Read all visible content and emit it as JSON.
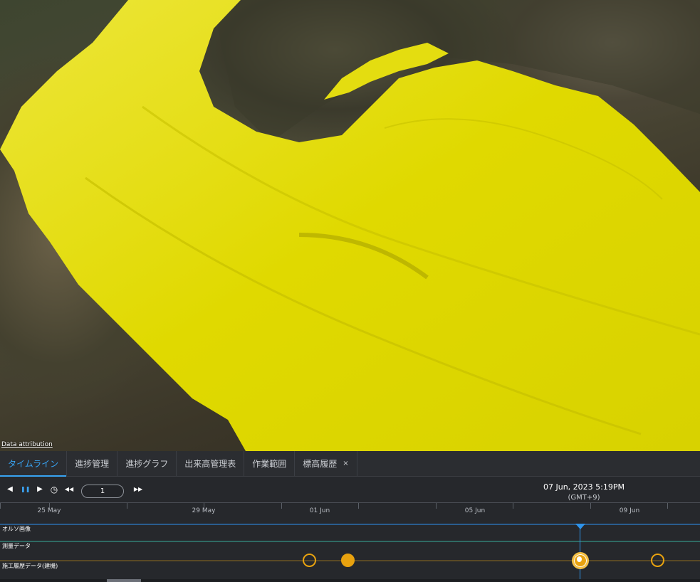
{
  "viewport": {
    "attribution_label": "Data attribution",
    "overlay_color": "#e6e000"
  },
  "tabs": [
    {
      "label": "タイムライン",
      "active": true
    },
    {
      "label": "進捗管理"
    },
    {
      "label": "進捗グラフ"
    },
    {
      "label": "出来高管理表"
    },
    {
      "label": "作業範囲"
    },
    {
      "label": "標高履歴",
      "closable": true,
      "close_glyph": "×"
    }
  ],
  "player": {
    "speed_value": "1",
    "current_time": "07 Jun, 2023 5:19PM",
    "timezone": "(GMT+9)",
    "icons": {
      "step_back": "◀",
      "pause": "❚❚",
      "play": "▶",
      "clock": "◷",
      "rewind": "◀◀",
      "fast_forward": "▶▶"
    }
  },
  "ruler": {
    "labels": [
      "25 May",
      "29 May",
      "01 Jun",
      "05 Jun",
      "09 Jun"
    ]
  },
  "tracks": [
    {
      "label": "オルソ画像",
      "color": "#2a5d8f"
    },
    {
      "label": "測量データ",
      "color": "#2f6a63"
    },
    {
      "label": "施工履歴データ(建機)",
      "color": "#5a4a26"
    }
  ],
  "colors": {
    "accent": "#38a3f2",
    "marker": "#e8a20f"
  }
}
